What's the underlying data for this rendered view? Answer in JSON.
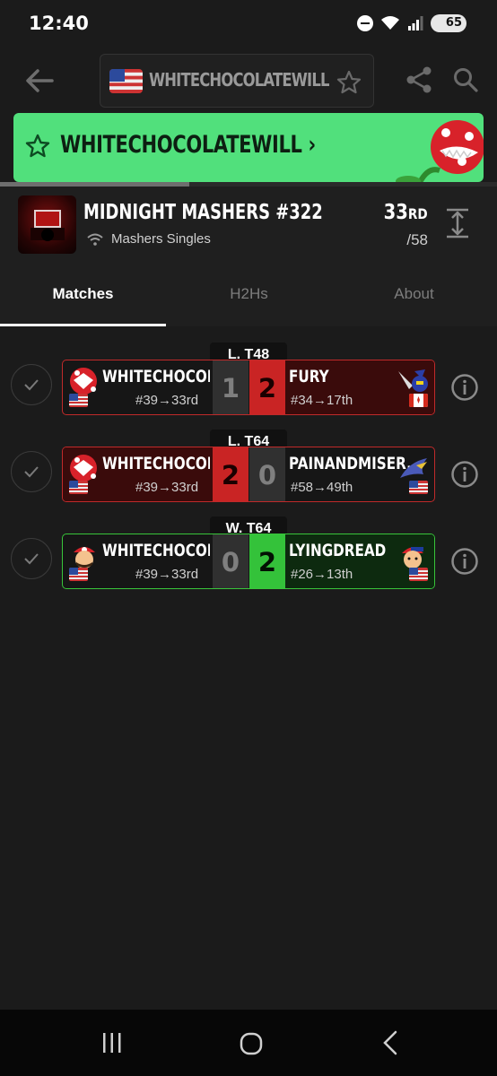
{
  "status_bar": {
    "time": "12:40",
    "battery": "65",
    "icons": [
      "do-not-disturb-icon",
      "wifi-icon",
      "signal-icon",
      "battery-icon"
    ]
  },
  "header": {
    "player_tag": "WHITECHOCOLATEWILL",
    "flag": "US",
    "icons": [
      "back-arrow-icon",
      "star-icon",
      "share-icon",
      "search-icon"
    ]
  },
  "banner": {
    "label": "WHITECHOCOLATEWILL",
    "chevron": "›",
    "color": "#51e07c"
  },
  "tournament": {
    "title": "MIDNIGHT MASHERS #322",
    "event": "Mashers Singles",
    "placement": "33",
    "placement_suffix": "RD",
    "entrants": "/58"
  },
  "tabs": [
    {
      "label": "Matches",
      "active": true
    },
    {
      "label": "H2Hs",
      "active": false
    },
    {
      "label": "About",
      "active": false
    }
  ],
  "matches": [
    {
      "round": "L. T48",
      "result": "loss",
      "p1": {
        "name": "WHITECHOCOLA...",
        "seed": "#39→33rd",
        "score": "1",
        "character": "piranha-plant",
        "flag": "US"
      },
      "p2": {
        "name": "FURY",
        "seed": "#34→17th",
        "score": "2",
        "character": "meta-knight",
        "flag": "CA"
      }
    },
    {
      "round": "L. T64",
      "result": "win",
      "p1": {
        "name": "WHITECHOCOLA...",
        "seed": "#39→33rd",
        "score": "2",
        "character": "piranha-plant",
        "flag": "US"
      },
      "p2": {
        "name": "PAINANDMISER...",
        "seed": "#58→49th",
        "score": "0",
        "character": "falco",
        "flag": "US"
      }
    },
    {
      "round": "W. T64",
      "result": "loss",
      "p1": {
        "name": "WHITECHOCOLA...",
        "seed": "#39→33rd",
        "score": "0",
        "character": "mario",
        "flag": "US"
      },
      "p2": {
        "name": "LYINGDREAD",
        "seed": "#26→13th",
        "score": "2",
        "character": "ness",
        "flag": "US"
      }
    }
  ],
  "colors": {
    "loss": "#c92424",
    "win": "#34c23a",
    "background": "#1b1b1b"
  },
  "nav": {
    "icons": [
      "recent-apps-icon",
      "home-icon",
      "back-icon"
    ]
  }
}
